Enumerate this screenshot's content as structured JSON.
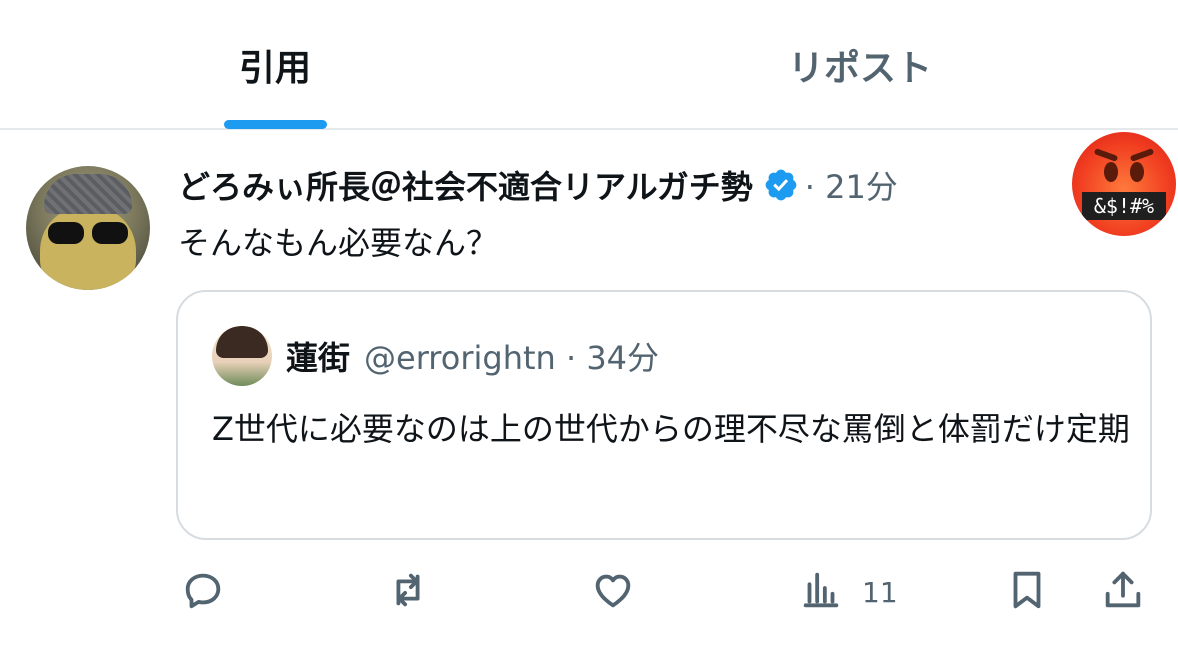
{
  "tabs": [
    {
      "label": "引用",
      "active": true
    },
    {
      "label": "リポスト",
      "active": false
    }
  ],
  "post": {
    "author_name": "どろみぃ所長＠社会不適合リアルガチ勢",
    "meta": "· 21分",
    "text": "そんなもん必要なん？",
    "reaction_badge_text": "&$!#%"
  },
  "quoted_post": {
    "author_name": "蓮街",
    "handle_and_time": "@errorightn · 34分",
    "text": "Z世代に必要なのは上の世代からの理不尽な罵倒と体罰だけ定期"
  },
  "actions": {
    "views_count": "11",
    "icons": [
      "reply-icon",
      "repost-icon",
      "like-icon",
      "views-icon",
      "bookmark-icon",
      "share-icon"
    ]
  },
  "colors": {
    "accent": "#1d9bf0",
    "text_primary": "#0f1419",
    "text_secondary": "#536471",
    "border": "#d7dce0"
  }
}
